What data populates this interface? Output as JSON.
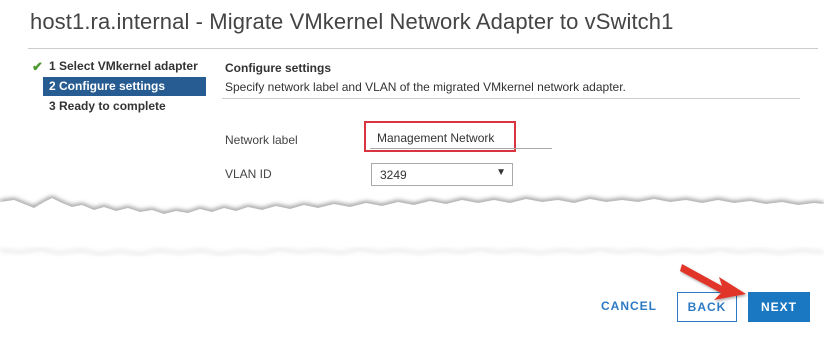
{
  "window": {
    "title": "host1.ra.internal - Migrate VMkernel Network Adapter to vSwitch1"
  },
  "steps": [
    {
      "label": "1 Select VMkernel adapter",
      "state": "completed",
      "icon": "checkmark-icon"
    },
    {
      "label": "2 Configure settings",
      "state": "active"
    },
    {
      "label": "3 Ready to complete",
      "state": "pending"
    }
  ],
  "content": {
    "heading": "Configure settings",
    "description": "Specify network label and VLAN of the migrated VMkernel network adapter."
  },
  "form": {
    "network_label": {
      "label": "Network label",
      "value": "Management Network"
    },
    "vlan_id": {
      "label": "VLAN ID",
      "value": "3249",
      "caret": "▼"
    }
  },
  "buttons": {
    "cancel": "CANCEL",
    "back": "BACK",
    "next": "NEXT"
  },
  "colors": {
    "accent": "#1a77c2",
    "active_step": "#275c92",
    "highlight": "#d9343f",
    "check": "#4a9a2f"
  }
}
